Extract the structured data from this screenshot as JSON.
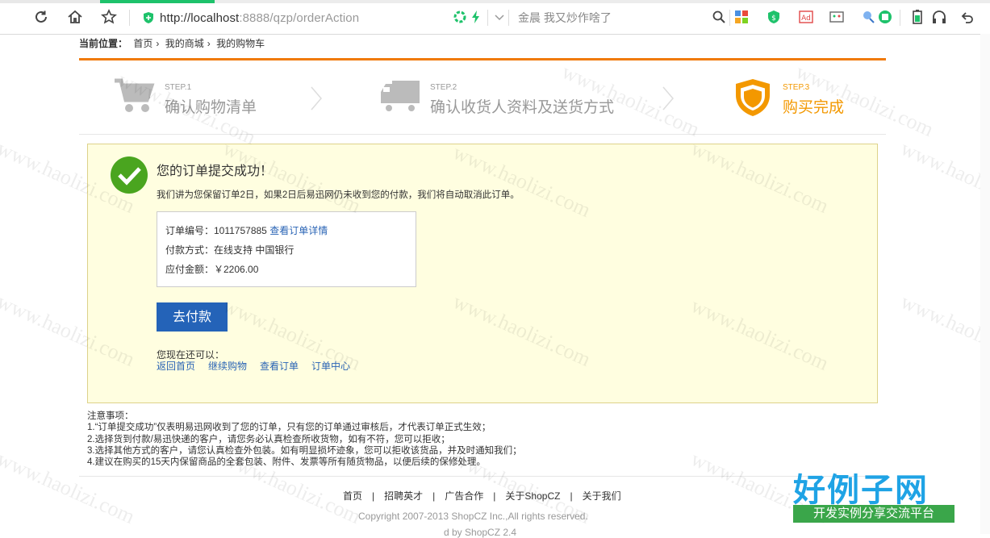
{
  "browser": {
    "url_host": "http://localhost",
    "url_rest": ":8888/qzp/orderAction",
    "search_hint": "金晨 我又炒作啥了",
    "tab_colors": [
      "#e8e8e8",
      "#1ec26b",
      "#e8e8e8"
    ]
  },
  "breadcrumb": {
    "label": "当前位置：",
    "items": [
      "首页",
      "我的商城",
      "我的购物车"
    ],
    "separator": "›"
  },
  "steps": [
    {
      "num": "STEP.1",
      "title": "确认购物清单",
      "icon": "cart-icon",
      "active": false
    },
    {
      "num": "STEP.2",
      "title": "确认收货人资料及送货方式",
      "icon": "truck-icon",
      "active": false
    },
    {
      "num": "STEP.3",
      "title": "购买完成",
      "icon": "shield-icon",
      "active": true
    }
  ],
  "success": {
    "title": "您的订单提交成功！",
    "note": "我们讲为您保留订单2日，如果2日后易迅网仍未收到您的付款，我们将自动取消此订单。",
    "order_label": "订单编号：1011757885",
    "order_link": "查看订单详情",
    "pay_method": "付款方式：在线支持 中国银行",
    "amount": "应付金额：￥2206.00",
    "pay_button": "去付款",
    "also_can": "您现在还可以：",
    "links": [
      "返回首页",
      "继续购物",
      "查看订单",
      "订单中心"
    ]
  },
  "notices": {
    "title": "注意事项：",
    "items": [
      "1.“订单提交成功”仅表明易迅网收到了您的订单，只有您的订单通过审核后，才代表订单正式生效；",
      "2.选择货到付款/易迅快递的客户，请您务必认真检查所收货物，如有不符，您可以拒收；",
      "3.选择其他方式的客户，请您认真检查外包装。如有明显损坏迹象，您可以拒收该货品，并及时通知我们；",
      "4.建议在购买的15天内保留商品的全套包装、附件、发票等所有随货物品，以便后续的保修处理。"
    ]
  },
  "footer": {
    "links": [
      "首页",
      "招聘英才",
      "广告合作",
      "关于ShopCZ",
      "关于我们"
    ],
    "separator": "|",
    "copyright": "Copyright 2007-2013 ShopCZ Inc.,All rights reserved.",
    "powered": "d by ShopCZ 2.4"
  },
  "watermark": {
    "text": "www.haolizi.com",
    "brand_big": "好例子网",
    "brand_small": "开发实例分享交流平台"
  },
  "colors": {
    "accent_orange": "#f07a0a",
    "step_active": "#f39800",
    "link_blue": "#2a64b5",
    "pay_button": "#2463b8",
    "success_green": "#4aa51f",
    "box_bg": "#fffee0"
  }
}
